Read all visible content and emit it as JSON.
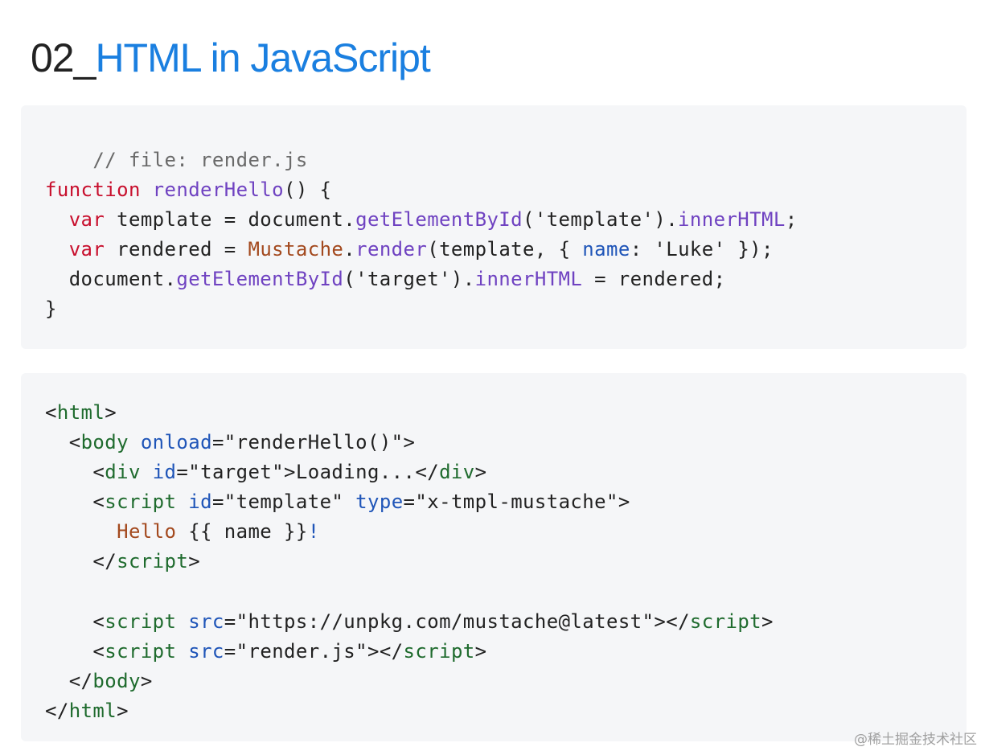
{
  "title": {
    "number": "02_",
    "text": "HTML in JavaScript"
  },
  "js_code": {
    "comment": "// file: render.js",
    "line1": {
      "kw": "function",
      "name": "renderHello",
      "rest": "() {"
    },
    "line2": {
      "kw": "var",
      "a": " template = document.",
      "fn": "getElementById",
      "b": "('template').",
      "prop": "innerHTML",
      "c": ";"
    },
    "line3": {
      "kw": "var",
      "a": " rendered = ",
      "cls": "Mustache",
      "b": ".",
      "fn": "render",
      "c": "(template, { ",
      "prop": "name",
      "d": ": 'Luke' });"
    },
    "line4": {
      "a": "document.",
      "fn": "getElementById",
      "b": "('target').",
      "prop": "innerHTML",
      "c": " = rendered;"
    },
    "line5": "}"
  },
  "html_code": {
    "l1": {
      "open": "<",
      "tag": "html",
      "close": ">"
    },
    "l2": {
      "open": "<",
      "tag": "body",
      "attr": "onload",
      "val": "=\"renderHello()\"",
      "close": ">"
    },
    "l3": {
      "open": "<",
      "tag": "div",
      "attr": "id",
      "val": "=\"target\">Loading...</",
      "tag2": "div",
      "close": ">"
    },
    "l4": {
      "open": "<",
      "tag": "script",
      "attr1": "id",
      "val1": "=\"template\" ",
      "attr2": "type",
      "val2": "=\"x-tmpl-mustache\">"
    },
    "l5": {
      "a": "Hello",
      "b": " {{ name }}",
      "c": "!"
    },
    "l6": {
      "open": "</",
      "tag": "script",
      "close": ">"
    },
    "l7": {
      "open": "<",
      "tag": "script",
      "attr": "src",
      "val": "=\"https://unpkg.com/mustache@latest\"></",
      "tag2": "script",
      "close": ">"
    },
    "l8": {
      "open": "<",
      "tag": "script",
      "attr": "src",
      "val": "=\"render.js\"></",
      "tag2": "script",
      "close": ">"
    },
    "l9": {
      "open": "</",
      "tag": "body",
      "close": ">"
    },
    "l10": {
      "open": "</",
      "tag": "html",
      "close": ">"
    }
  },
  "watermark": "@稀土掘金技术社区"
}
